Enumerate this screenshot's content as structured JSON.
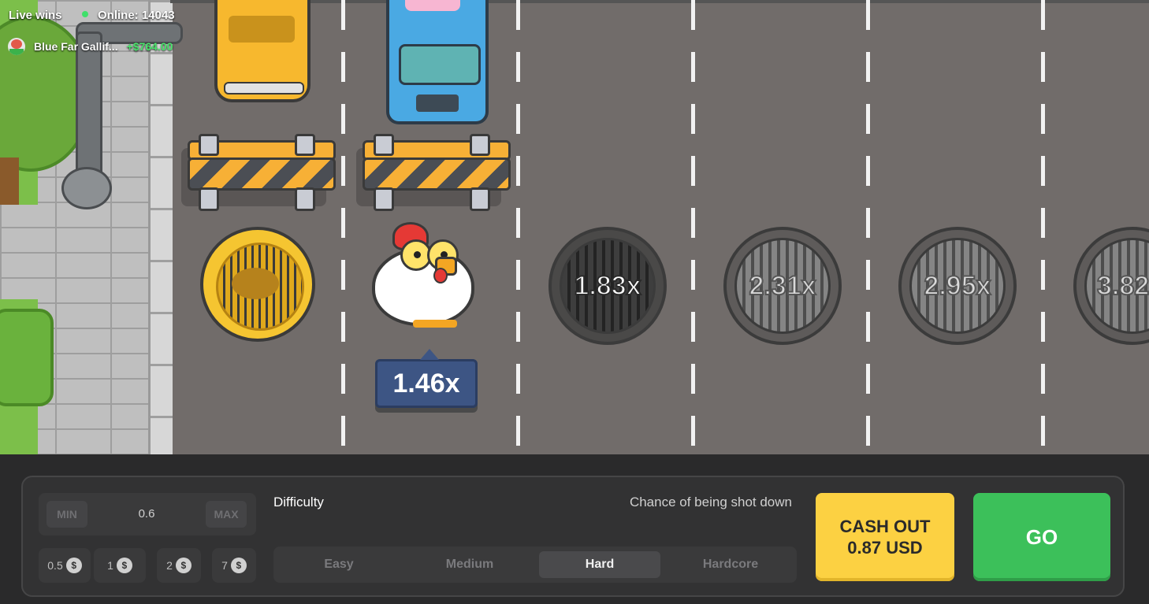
{
  "live_wins": {
    "label": "Live wins",
    "online": "Online: 14043",
    "winner_name": "Blue Far Gallif...",
    "winner_amount": "+$764.00"
  },
  "game": {
    "current_multiplier": "1.46x",
    "lanes": [
      {
        "multiplier": "1.83x",
        "state": "next"
      },
      {
        "multiplier": "2.31x",
        "state": "locked"
      },
      {
        "multiplier": "2.95x",
        "state": "locked"
      },
      {
        "multiplier": "3.82",
        "state": "locked"
      }
    ]
  },
  "controls": {
    "min_label": "MIN",
    "max_label": "MAX",
    "bet_value": "0.6",
    "chips": [
      "0.5",
      "1",
      "2",
      "7"
    ],
    "chip_currency_symbol": "$",
    "difficulty_label": "Difficulty",
    "chance_label": "Chance of being shot down",
    "difficulties": [
      "Easy",
      "Medium",
      "Hard",
      "Hardcore"
    ],
    "selected_difficulty": "Hard",
    "cashout_line1": "CASH OUT",
    "cashout_line2": "0.87 USD",
    "go_label": "GO"
  },
  "colors": {
    "road": "#716c6a",
    "cashout": "#fcd142",
    "go": "#3cc05a",
    "badge": "#3d5584",
    "winner_amount": "#49e36b"
  }
}
